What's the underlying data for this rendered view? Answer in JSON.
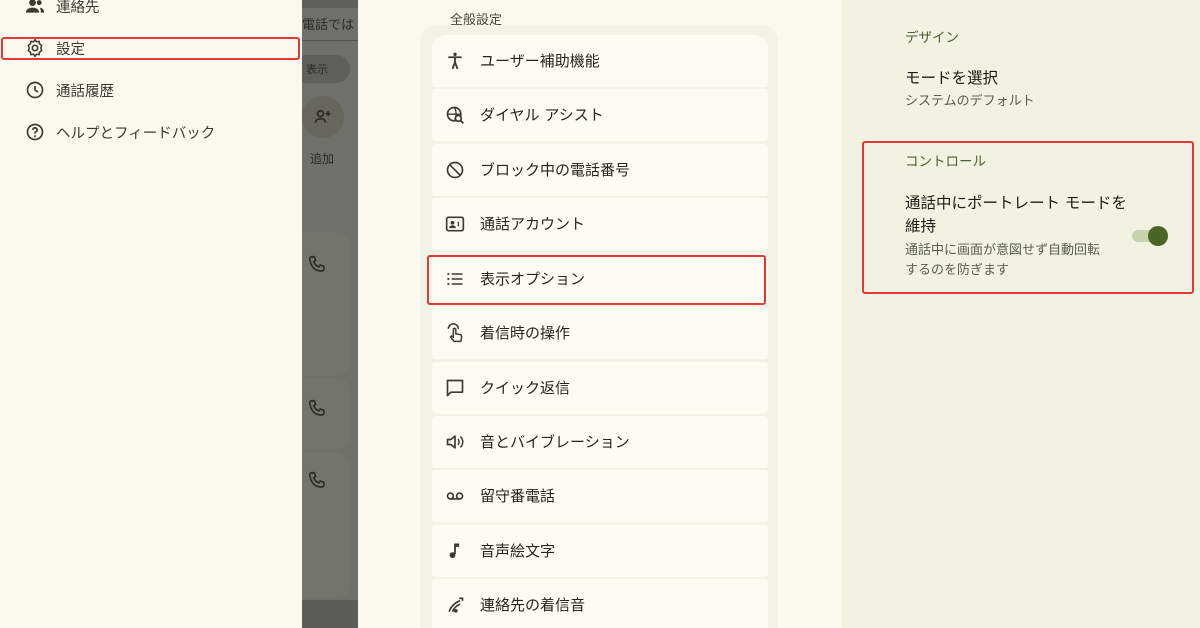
{
  "drawer": {
    "items": [
      {
        "icon": "contacts-icon",
        "label": "連絡先"
      },
      {
        "icon": "gear-icon",
        "label": "設定"
      },
      {
        "icon": "history-icon",
        "label": "通話履歴"
      },
      {
        "icon": "help-icon",
        "label": "ヘルプとフィードバック"
      }
    ]
  },
  "background_app": {
    "tab_title": "電話では",
    "chip_label": "表示",
    "add_label": "追加"
  },
  "settings": {
    "section_title": "全般設定",
    "items": [
      {
        "icon": "accessibility-icon",
        "label": "ユーザー補助機能"
      },
      {
        "icon": "dial-assist-icon",
        "label": "ダイヤル アシスト"
      },
      {
        "icon": "block-icon",
        "label": "ブロック中の電話番号"
      },
      {
        "icon": "account-card-icon",
        "label": "通話アカウント"
      },
      {
        "icon": "list-icon",
        "label": "表示オプション"
      },
      {
        "icon": "gesture-icon",
        "label": "着信時の操作"
      },
      {
        "icon": "message-icon",
        "label": "クイック返信"
      },
      {
        "icon": "volume-icon",
        "label": "音とバイブレーション"
      },
      {
        "icon": "voicemail-icon",
        "label": "留守番電話"
      },
      {
        "icon": "music-note-icon",
        "label": "音声絵文字"
      },
      {
        "icon": "ringtone-icon",
        "label": "連絡先の着信音"
      }
    ]
  },
  "display_options": {
    "design_header": "デザイン",
    "mode_title": "モードを選択",
    "mode_summary": "システムのデフォルト",
    "controls_header": "コントロール",
    "portrait_title_line1": "通話中にポートレート モードを",
    "portrait_title_line2": "維持",
    "portrait_summary_line1": "通話中に画面が意図せず自動回転",
    "portrait_summary_line2": "するのを防ぎます",
    "portrait_enabled": true
  },
  "colors": {
    "highlight": "#e53935",
    "accent": "#4a6625"
  }
}
